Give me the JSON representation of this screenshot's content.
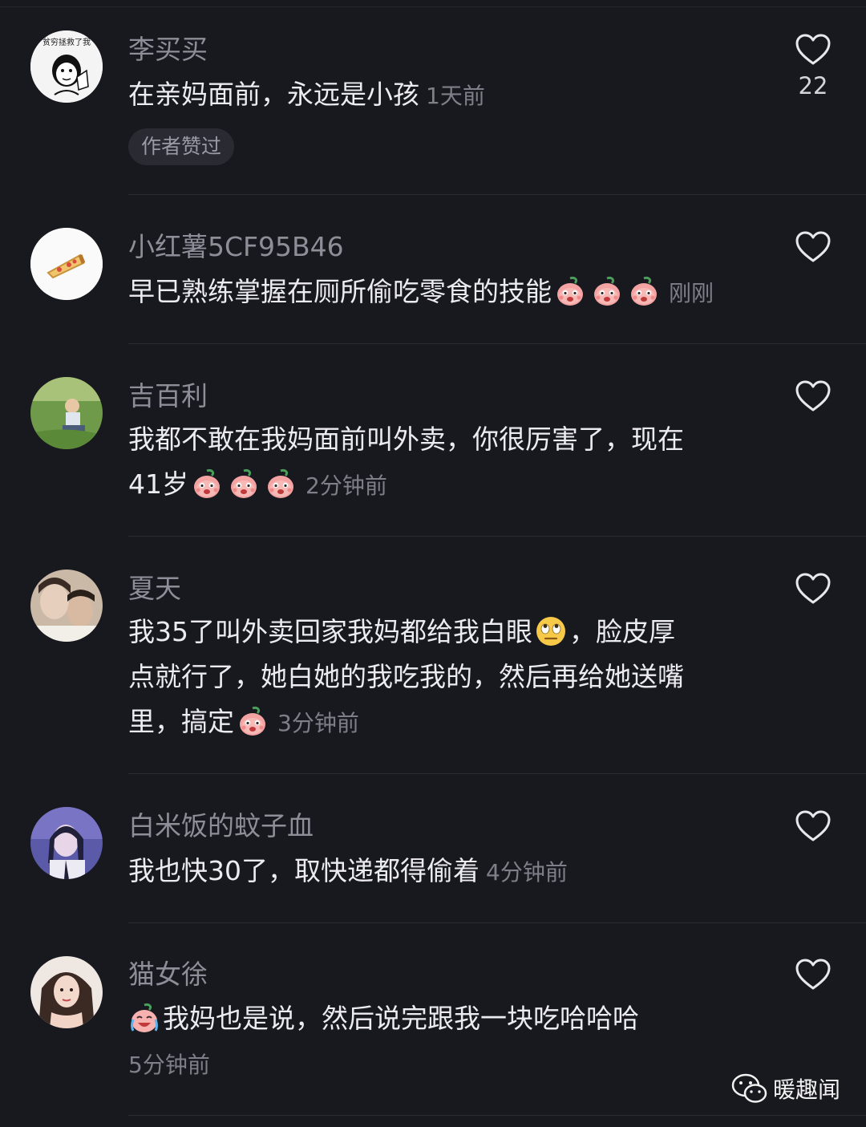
{
  "comments": [
    {
      "username": "李买买",
      "text": "在亲妈面前，永远是小孩",
      "time": "1天前",
      "badge": "作者赞过",
      "like_count": "22",
      "avatar_icon": "meme-cartoon-avatar",
      "avatar_caption": "贫穷拯救了我"
    },
    {
      "username": "小红薯5CF95B46",
      "text": "早已熟练掌握在厕所偷吃零食的技能",
      "time": "刚刚",
      "emoji_count": 3,
      "avatar_icon": "pizza-slice-avatar"
    },
    {
      "username": "吉百利",
      "text_line1": "我都不敢在我妈面前叫外卖，你很厉害了，现在",
      "text_line2": "41岁",
      "time": "2分钟前",
      "emoji_count": 3,
      "avatar_icon": "child-on-grass-photo"
    },
    {
      "username": "夏天",
      "text_line1a": "我35了叫外卖回家我妈都给我白眼",
      "text_line1b": "，脸皮厚",
      "text_line2": "点就行了，她白她的我吃我的，然后再给她送嘴",
      "text_line3": "里，搞定",
      "time": "3分钟前",
      "avatar_icon": "couple-photo"
    },
    {
      "username": "白米饭的蚊子血",
      "text": "我也快30了，取快递都得偷着",
      "time": "4分钟前",
      "avatar_icon": "girl-purple-photo"
    },
    {
      "username": "猫女徐",
      "text": "我妈也是说，然后说完跟我一块吃哈哈哈",
      "time": "5分钟前",
      "avatar_icon": "woman-portrait-photo"
    }
  ],
  "watermark": {
    "label": "暖趣闻",
    "icon": "wechat-icon"
  },
  "colors": {
    "background": "#18181f",
    "username": "#8e8e98",
    "text": "#ecebf0",
    "time": "#7f7f89"
  }
}
